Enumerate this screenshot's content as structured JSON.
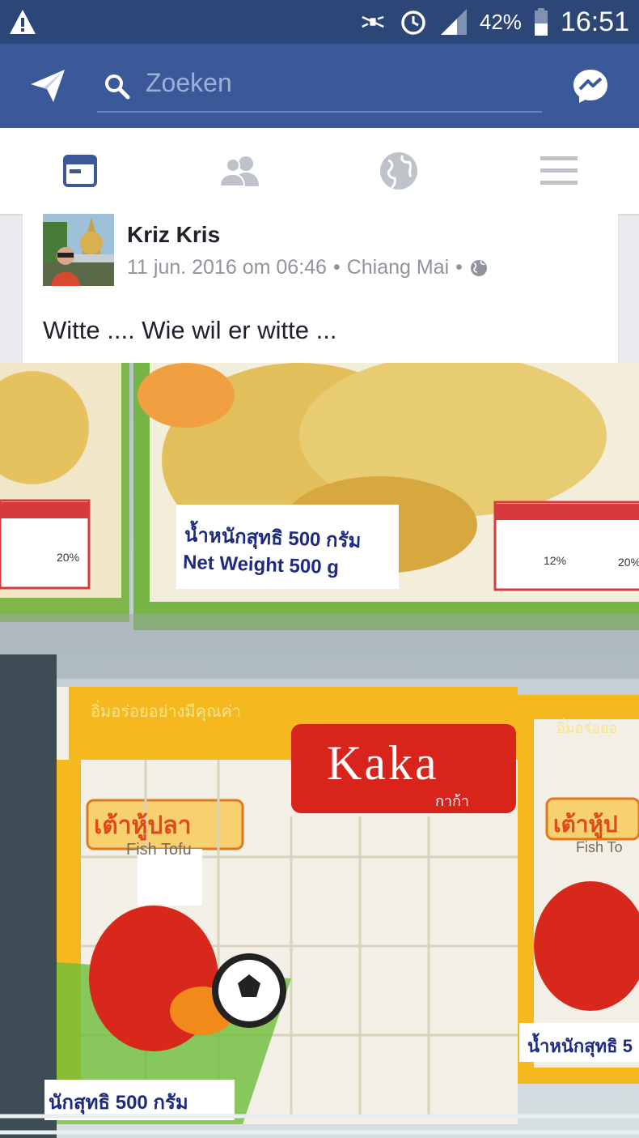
{
  "status_bar": {
    "battery_percent": "42%",
    "time": "16:51",
    "icons": [
      "warning-icon",
      "mute-icon",
      "alarm-icon",
      "signal-icon",
      "battery-icon"
    ]
  },
  "app_bar": {
    "search_placeholder": "Zoeken",
    "icons": [
      "send-icon",
      "search-icon",
      "messenger-icon"
    ]
  },
  "tabs": [
    {
      "name": "news-feed",
      "icon": "news-feed-icon",
      "active": true
    },
    {
      "name": "friends",
      "icon": "friends-icon",
      "active": false
    },
    {
      "name": "notifications",
      "icon": "globe-icon",
      "active": false
    },
    {
      "name": "menu",
      "icon": "menu-icon",
      "active": false
    }
  ],
  "post": {
    "author": "Kriz Kris",
    "date": "11 jun. 2016 om 06:46",
    "location": "Chiang Mai",
    "text": "Witte .... Wie wil er witte ...",
    "photo": {
      "top_label_thai": "น้ำหนักสุทธิ 500 กรัม",
      "top_label_en": "Net Weight 500 g",
      "top_left_pct": "20%",
      "top_right_pct1": "12%",
      "top_right_pct2": "20%",
      "brand": "Kaka",
      "brand_thai": "กาก้า",
      "product_thai": "เต้าหู้ปลา",
      "product_en": "Fish Tofu",
      "slogan_thai": "อิ่มอร่อยอย่างมีคุณค่า",
      "bottom_weight_thai": "นักสุทธิ 500 กรัม",
      "right_weight_thai": "น้ำหนักสุทธิ 5",
      "right_product_thai": "เต้าหู้ป",
      "right_product_en": "Fish To",
      "right_slogan_thai": "อิ่มอร่อยอ"
    }
  },
  "colors": {
    "status_bar": "#2c4677",
    "app_bar": "#3b5998",
    "active_tab": "#3b5998",
    "inactive_tab": "#bec2c9"
  }
}
